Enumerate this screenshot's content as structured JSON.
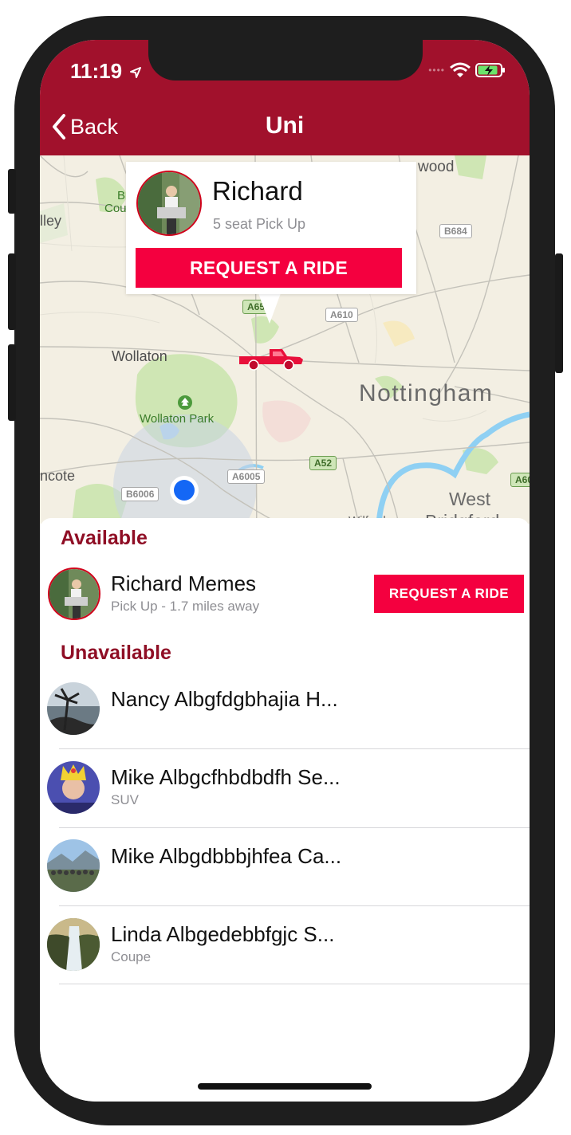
{
  "status": {
    "time": "11:19"
  },
  "nav": {
    "back_label": "Back",
    "title": "Uni"
  },
  "map": {
    "place_labels": {
      "wollaton": "Wollaton",
      "wollaton_park": "Wollaton Park",
      "nottingham": "Nottingham",
      "west": "West",
      "bridgford": "Bridgford",
      "lley": "lley",
      "ncote": "ncote",
      "wood": "wood",
      "b": "B",
      "cou": "Cou",
      "wilford": "Wilford"
    },
    "road_labels": {
      "b684": "B684",
      "a610": "A610",
      "a65": "A65",
      "a52": "A52",
      "a6005": "A6005",
      "b6006": "B6006",
      "a60": "A60"
    }
  },
  "callout": {
    "name": "Richard",
    "subtitle": "5 seat Pick Up",
    "button_label": "REQUEST A RIDE"
  },
  "available": {
    "section_title": "Available",
    "items": [
      {
        "name": "Richard Memes",
        "subtitle": "Pick Up - 1.7 miles away",
        "button_label": "REQUEST A RIDE"
      }
    ]
  },
  "unavailable": {
    "section_title": "Unavailable",
    "items": [
      {
        "name": "Nancy Albgfdgbhajia H...",
        "subtitle": ""
      },
      {
        "name": "Mike Albgcfhbdbdfh Se...",
        "subtitle": "SUV"
      },
      {
        "name": "Mike Albgdbbbjhfea Ca...",
        "subtitle": ""
      },
      {
        "name": "Linda Albgedebbfgjc S...",
        "subtitle": "Coupe"
      }
    ]
  },
  "colors": {
    "header": "#a1112c",
    "accent_button": "#f4003f",
    "section_title": "#8f0e25"
  }
}
